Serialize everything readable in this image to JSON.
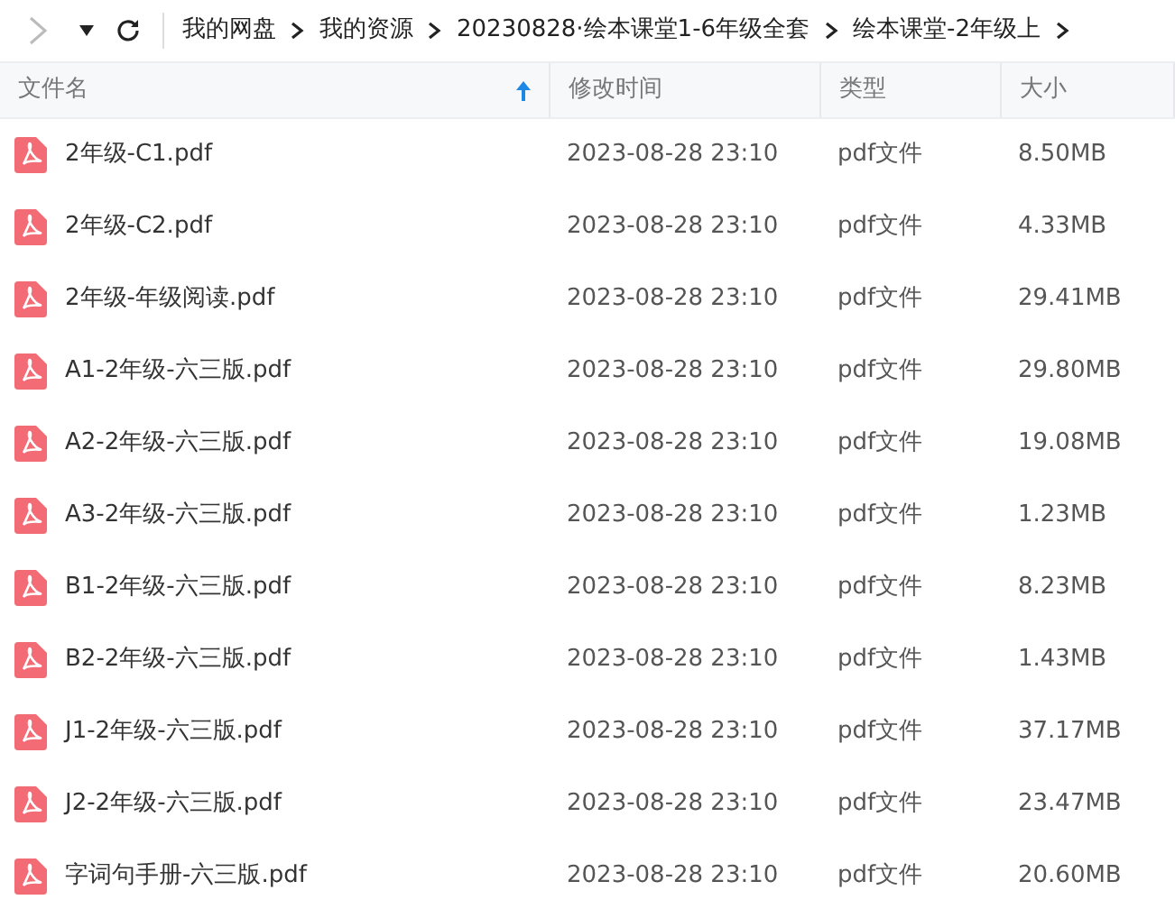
{
  "breadcrumb": [
    "我的网盘",
    "我的资源",
    "20230828·绘本课堂1-6年级全套",
    "绘本课堂-2年级上"
  ],
  "columns": [
    {
      "label": "文件名",
      "sorted": true
    },
    {
      "label": "修改时间",
      "sorted": false
    },
    {
      "label": "类型",
      "sorted": false
    },
    {
      "label": "大小",
      "sorted": false
    }
  ],
  "rows": [
    {
      "name": "2年级-C1.pdf",
      "modified": "2023-08-28 23:10",
      "type": "pdf文件",
      "size": "8.50MB"
    },
    {
      "name": "2年级-C2.pdf",
      "modified": "2023-08-28 23:10",
      "type": "pdf文件",
      "size": "4.33MB"
    },
    {
      "name": "2年级-年级阅读.pdf",
      "modified": "2023-08-28 23:10",
      "type": "pdf文件",
      "size": "29.41MB"
    },
    {
      "name": "A1-2年级-六三版.pdf",
      "modified": "2023-08-28 23:10",
      "type": "pdf文件",
      "size": "29.80MB"
    },
    {
      "name": "A2-2年级-六三版.pdf",
      "modified": "2023-08-28 23:10",
      "type": "pdf文件",
      "size": "19.08MB"
    },
    {
      "name": "A3-2年级-六三版.pdf",
      "modified": "2023-08-28 23:10",
      "type": "pdf文件",
      "size": "1.23MB"
    },
    {
      "name": "B1-2年级-六三版.pdf",
      "modified": "2023-08-28 23:10",
      "type": "pdf文件",
      "size": "8.23MB"
    },
    {
      "name": "B2-2年级-六三版.pdf",
      "modified": "2023-08-28 23:10",
      "type": "pdf文件",
      "size": "1.43MB"
    },
    {
      "name": "J1-2年级-六三版.pdf",
      "modified": "2023-08-28 23:10",
      "type": "pdf文件",
      "size": "37.17MB"
    },
    {
      "name": "J2-2年级-六三版.pdf",
      "modified": "2023-08-28 23:10",
      "type": "pdf文件",
      "size": "23.47MB"
    },
    {
      "name": "字词句手册-六三版.pdf",
      "modified": "2023-08-28 23:10",
      "type": "pdf文件",
      "size": "20.60MB"
    }
  ]
}
